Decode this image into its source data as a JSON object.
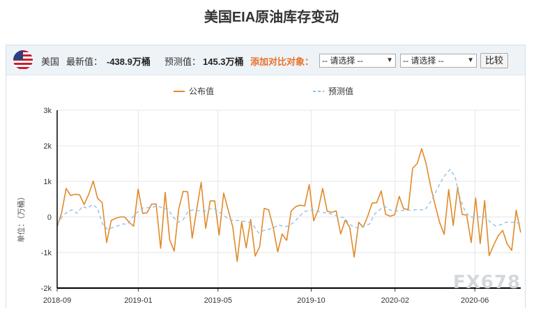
{
  "page": {
    "title": "美国EIA原油库存变动"
  },
  "toolbar": {
    "country": "美国",
    "latest_label": "最新值：",
    "latest_value": "-438.9万桶",
    "forecast_label": "预测值：",
    "forecast_value": "145.3万桶",
    "compare_label": "添加对比对象：",
    "select_1": "-- 请选择 --",
    "select_2": "-- 请选择 --",
    "compare_button": "比较"
  },
  "watermark": "FX678",
  "colors": {
    "actual": "#e08a2a",
    "forecast": "#92c0e6",
    "axis": "#000000",
    "grid": "#e6e6e6"
  },
  "chart_data": {
    "type": "line",
    "ylabel": "单位：（万桶）",
    "ylim": [
      -2000,
      3000
    ],
    "yticks": [
      -2000,
      -1000,
      0,
      1000,
      2000,
      3000
    ],
    "ytick_labels": [
      "-2k",
      "-1k",
      "0",
      "1k",
      "2k",
      "3k"
    ],
    "xlim": [
      0,
      100
    ],
    "xticks": [
      {
        "x": 0,
        "label": "2018-09"
      },
      {
        "x": 17.5,
        "label": "2019-01"
      },
      {
        "x": 34.7,
        "label": "2019-05"
      },
      {
        "x": 54.8,
        "label": "2019-10"
      },
      {
        "x": 72.9,
        "label": "2020-02"
      },
      {
        "x": 90.1,
        "label": "2020-06"
      }
    ],
    "legend": {
      "position": "top"
    },
    "series": [
      {
        "name": "公布值",
        "style": "solid",
        "values": [
          -270,
          120,
          800,
          600,
          640,
          620,
          350,
          630,
          1010,
          520,
          400,
          -720,
          -100,
          -40,
          0,
          0,
          -150,
          -260,
          780,
          100,
          120,
          360,
          360,
          -880,
          690,
          -640,
          -960,
          210,
          720,
          710,
          -600,
          200,
          970,
          -320,
          450,
          450,
          -510,
          670,
          200,
          -270,
          -1250,
          -140,
          -870,
          -70,
          -1100,
          -840,
          240,
          200,
          -290,
          -980,
          -480,
          -660,
          160,
          290,
          330,
          310,
          910,
          -110,
          200,
          800,
          160,
          130,
          170,
          -480,
          -90,
          -290,
          -1130,
          -150,
          -290,
          20,
          390,
          400,
          730,
          70,
          20,
          60,
          580,
          230,
          210,
          1370,
          1500,
          1920,
          1490,
          850,
          330,
          -160,
          -490,
          770,
          -240,
          830,
          70,
          50,
          -720,
          530,
          -750,
          460,
          -1090,
          -790,
          -530,
          -380,
          -760,
          -940,
          190,
          -439
        ]
      },
      {
        "name": "预测值",
        "style": "dashed",
        "values": [
          -210,
          0,
          150,
          200,
          100,
          300,
          240,
          350,
          250,
          -200,
          -350,
          -300,
          -250,
          -200,
          -200,
          0,
          150,
          250,
          260,
          280,
          300,
          250,
          220,
          0,
          -150,
          -80,
          160,
          200,
          180,
          150,
          200,
          250,
          150,
          50,
          -60,
          -100,
          -100,
          -120,
          -150,
          -250,
          -450,
          -380,
          -350,
          -300,
          -220,
          -280,
          -250,
          -150,
          0,
          150,
          180,
          200,
          150,
          120,
          100,
          50,
          0,
          -20,
          -200,
          -300,
          -300,
          -250,
          -200,
          80,
          200,
          300,
          200,
          150,
          180,
          180,
          190,
          200,
          200,
          200,
          400,
          650,
          950,
          1180,
          1340,
          1120,
          500,
          150,
          0,
          0,
          0,
          0,
          -150,
          -250,
          -220,
          -150,
          -150,
          -150,
          -200
        ]
      }
    ]
  }
}
